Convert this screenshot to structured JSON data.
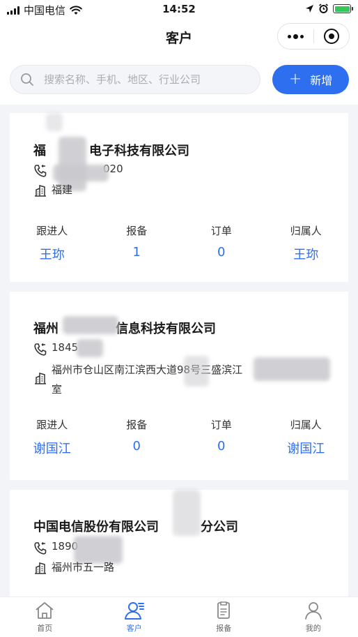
{
  "status_bar": {
    "carrier": "中国电信",
    "time": "14:52"
  },
  "nav": {
    "title": "客户"
  },
  "search": {
    "placeholder": "搜索名称、手机、地区、行业公司",
    "add_label": "新增"
  },
  "customers": [
    {
      "name_start": "福",
      "name_end": "电子科技有限公司",
      "phone_tail": "020",
      "address": "福建",
      "stats": [
        {
          "label": "跟进人",
          "value": "王珎"
        },
        {
          "label": "报备",
          "value": "1"
        },
        {
          "label": "订单",
          "value": "0"
        },
        {
          "label": "归属人",
          "value": "王珎"
        }
      ]
    },
    {
      "name_start": "福州",
      "name_end": "信息科技有限公司",
      "phone_head": "1845",
      "address": "福州市仓山区南江滨西大道98号三盛滨江",
      "address_end": "室",
      "stats": [
        {
          "label": "跟进人",
          "value": "谢国江"
        },
        {
          "label": "报备",
          "value": "0"
        },
        {
          "label": "订单",
          "value": "0"
        },
        {
          "label": "归属人",
          "value": "谢国江"
        }
      ]
    },
    {
      "name_start": "中国电信股份有限公司",
      "name_end": "分公司",
      "phone_head": "1890",
      "address": "福州市五一路"
    }
  ],
  "tabs": [
    {
      "label": "首页",
      "icon": "home-icon"
    },
    {
      "label": "客户",
      "icon": "customer-icon",
      "active": true
    },
    {
      "label": "报备",
      "icon": "report-icon"
    },
    {
      "label": "我的",
      "icon": "user-icon"
    }
  ],
  "colors": {
    "accent": "#2e6ff0",
    "background": "#f2f4f7"
  }
}
